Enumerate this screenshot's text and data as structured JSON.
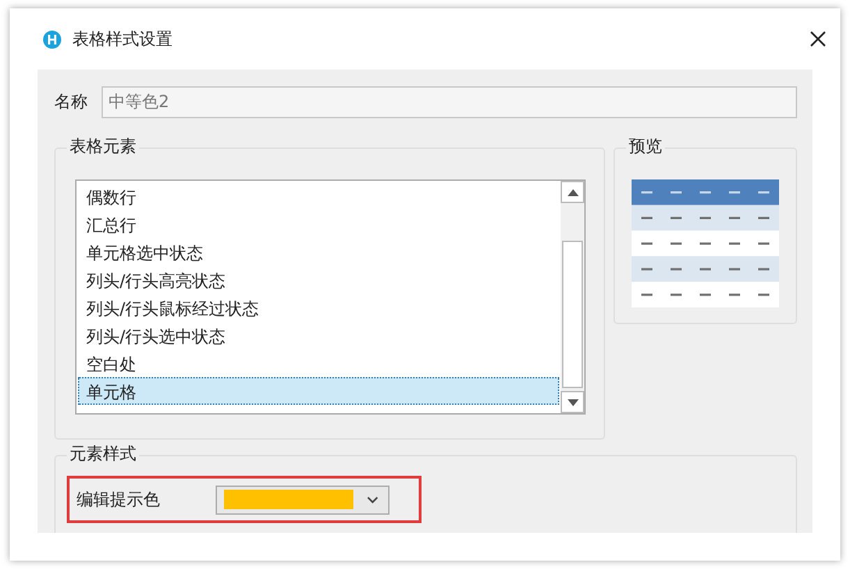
{
  "window": {
    "title": "表格样式设置"
  },
  "name_field": {
    "label": "名称",
    "value": "中等色2",
    "disabled": true
  },
  "table_elements": {
    "title": "表格元素",
    "items": [
      {
        "label": "偶数行",
        "selected": false
      },
      {
        "label": "汇总行",
        "selected": false
      },
      {
        "label": "单元格选中状态",
        "selected": false
      },
      {
        "label": "列头/行头高亮状态",
        "selected": false
      },
      {
        "label": "列头/行头鼠标经过状态",
        "selected": false
      },
      {
        "label": "列头/行头选中状态",
        "selected": false
      },
      {
        "label": "空白处",
        "selected": false
      },
      {
        "label": "单元格",
        "selected": true
      }
    ]
  },
  "preview": {
    "title": "预览"
  },
  "element_style": {
    "title": "元素样式",
    "fields": [
      {
        "label": "编辑提示色",
        "color": "#ffc000"
      }
    ]
  }
}
